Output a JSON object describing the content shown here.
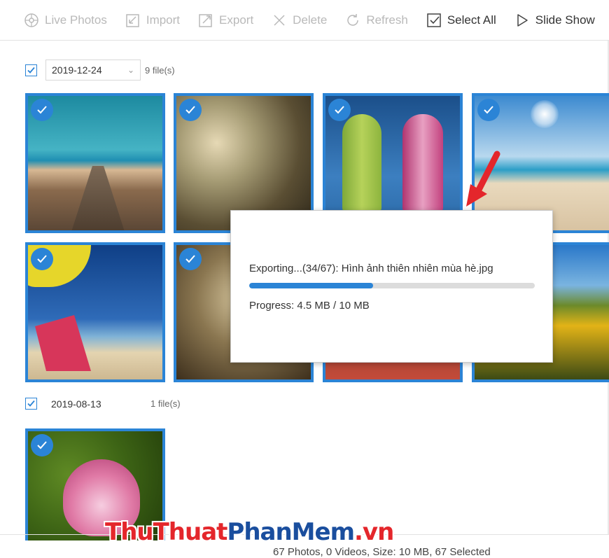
{
  "toolbar": {
    "items": [
      {
        "label": "Live Photos",
        "icon": "live-photos-icon",
        "enabled": false
      },
      {
        "label": "Import",
        "icon": "import-icon",
        "enabled": false
      },
      {
        "label": "Export",
        "icon": "export-icon",
        "enabled": false
      },
      {
        "label": "Delete",
        "icon": "delete-icon",
        "enabled": false
      },
      {
        "label": "Refresh",
        "icon": "refresh-icon",
        "enabled": false
      },
      {
        "label": "Select All",
        "icon": "checkbox-checked-icon",
        "enabled": true
      },
      {
        "label": "Slide Show",
        "icon": "play-icon",
        "enabled": true
      }
    ]
  },
  "groups": [
    {
      "date": "2019-12-24",
      "count": "9 file(s)",
      "checked": true,
      "has_dropdown": true
    },
    {
      "date": "2019-08-13",
      "count": "1 file(s)",
      "checked": true,
      "has_dropdown": false
    }
  ],
  "dialog": {
    "message": "Exporting...(34/67): Hình ảnh thiên nhiên mùa hè.jpg",
    "progress_fraction": 0.435,
    "progress_text": "Progress: 4.5 MB / 10 MB"
  },
  "status": {
    "text": "67 Photos, 0 Videos, Size: 10 MB, 67 Selected"
  },
  "watermark": {
    "part1": "ThuThuat",
    "part2": "PhanMem",
    "part3": ".vn"
  },
  "colors": {
    "accent": "#2b84d6",
    "disabled_text": "#b9b9b9",
    "arrow": "#e4262b"
  }
}
